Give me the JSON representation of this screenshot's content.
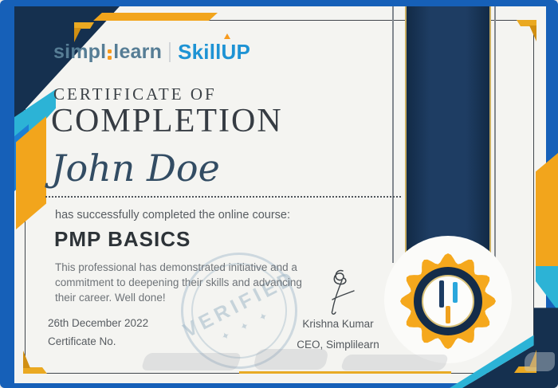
{
  "certificate": {
    "logo": {
      "brand_left": "simpl",
      "brand_right": "learn",
      "product_prefix": "Skill",
      "product_u": "U",
      "product_suffix": "P"
    },
    "heading_small": "CERTIFICATE OF",
    "heading_large": "COMPLETION",
    "recipient_name": "John Doe",
    "completion_line": "has successfully completed the online course:",
    "course_title": "PMP BASICS",
    "description_lines": [
      "This professional has demonstrated initiative and a",
      "commitment to deepening their skills and advancing",
      "their career. Well done!"
    ],
    "issue_date": "26th December 2022",
    "certificate_no_label": "Certificate No.",
    "signature": {
      "name": "Krishna Kumar",
      "title": "CEO, Simplilearn"
    },
    "stamp": {
      "text": "VERIFIED",
      "stars": "✦ ✦ ✦"
    }
  },
  "colors": {
    "frame_blue": "#1660b8",
    "navy": "#15304f",
    "gold": "#f2a51c",
    "teal": "#2cb3d6",
    "paper": "#f4f4f1",
    "logo_slate": "#567d95",
    "logo_blue": "#1e93d4",
    "logo_orange": "#f79b1f",
    "stamp_gray_blue": "#a6bccc"
  },
  "icons": {
    "badge": "simplilearn-bars-icon",
    "badge_frame": "gold-rosette-seal",
    "stamp": "verified-stamp",
    "logo_arrow": "skillup-arrow-icon",
    "watermark": "haraj-watermark-silhouette",
    "corners": "gold-corner-bracket"
  }
}
